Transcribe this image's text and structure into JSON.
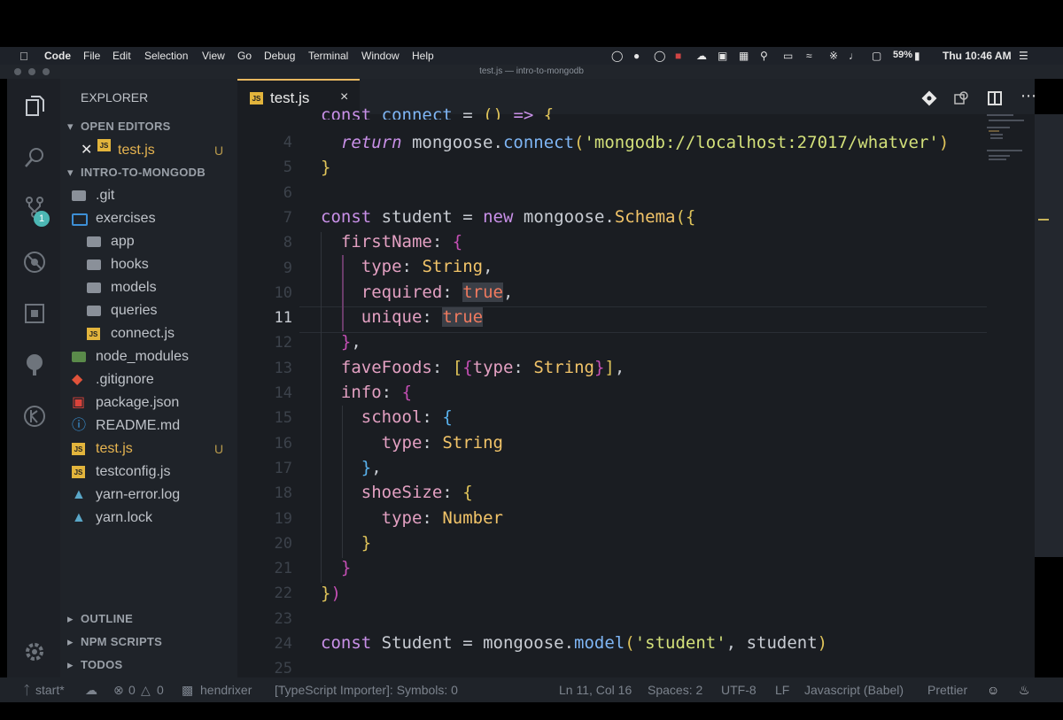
{
  "menubar": {
    "app": "Code",
    "items": [
      "File",
      "Edit",
      "Selection",
      "View",
      "Go",
      "Debug",
      "Terminal",
      "Window",
      "Help"
    ],
    "battery": "59%",
    "clock": "Thu 10:46 AM"
  },
  "window": {
    "title": "test.js — intro-to-mongodb"
  },
  "activity": {
    "scm_badge": "1"
  },
  "sidebar": {
    "title": "EXPLORER",
    "open_editors_label": "OPEN EDITORS",
    "open_editor": {
      "name": "test.js",
      "status": "U"
    },
    "project_label": "INTRO-TO-MONGODB",
    "tree": [
      {
        "name": ".git",
        "kind": "folder-git"
      },
      {
        "name": "exercises",
        "kind": "folder-open"
      },
      {
        "name": "app",
        "kind": "folder"
      },
      {
        "name": "hooks",
        "kind": "folder"
      },
      {
        "name": "models",
        "kind": "folder"
      },
      {
        "name": "queries",
        "kind": "folder"
      },
      {
        "name": "connect.js",
        "kind": "js"
      },
      {
        "name": "node_modules",
        "kind": "folder-node"
      },
      {
        "name": ".gitignore",
        "kind": "git"
      },
      {
        "name": "package.json",
        "kind": "npm"
      },
      {
        "name": "README.md",
        "kind": "info"
      },
      {
        "name": "test.js",
        "kind": "js",
        "status": "U"
      },
      {
        "name": "testconfig.js",
        "kind": "js"
      },
      {
        "name": "yarn-error.log",
        "kind": "yarn"
      },
      {
        "name": "yarn.lock",
        "kind": "yarn"
      }
    ],
    "outline_label": "OUTLINE",
    "npm_label": "NPM SCRIPTS",
    "todos_label": "TODOS"
  },
  "tab": {
    "name": "test.js",
    "close": "×"
  },
  "editor": {
    "line_numbers": [
      "4",
      "5",
      "6",
      "7",
      "8",
      "9",
      "10",
      "11",
      "12",
      "13",
      "14",
      "15",
      "16",
      "17",
      "18",
      "19",
      "20",
      "21",
      "22",
      "23",
      "24",
      "25"
    ],
    "cropped_line": "const connect = () => {",
    "current_line": "11"
  },
  "status": {
    "branch": "start*",
    "errors": "0",
    "warnings": "0",
    "user": "hendrixer",
    "importer": "[TypeScript Importer]: Symbols: 0",
    "position": "Ln 11, Col 16",
    "spaces": "Spaces: 2",
    "encoding": "UTF-8",
    "eol": "LF",
    "language": "Javascript (Babel)",
    "formatter": "Prettier"
  }
}
